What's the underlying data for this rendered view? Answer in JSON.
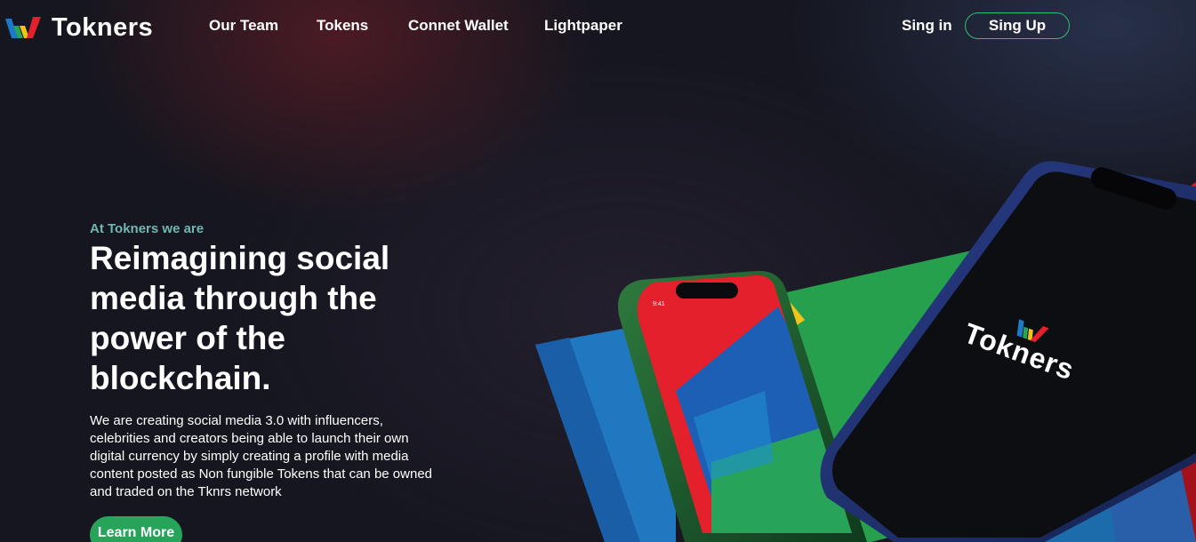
{
  "brand": {
    "name": "Tokners",
    "logo_icon": "tokners-w-logo-icon",
    "colors": {
      "blue": "#1e78c8",
      "green": "#27a35a",
      "yellow": "#f2c31b",
      "red": "#e3202b"
    }
  },
  "nav": {
    "items": [
      {
        "label": "Our Team"
      },
      {
        "label": "Tokens"
      },
      {
        "label": "Connet Wallet"
      },
      {
        "label": "Lightpaper"
      }
    ],
    "signin_label": "Sing in",
    "signup_label": "Sing Up"
  },
  "hero": {
    "eyebrow": "At Tokners we are",
    "headline": "Reimagining social media through the power of the blockchain.",
    "description": "We are creating social media 3.0 with influencers, celebrities and creators being able to launch their own digital currency by simply creating a profile with media content posted as Non fungible Tokens that can be owned and traded on the Tknrs network",
    "cta_label": "Learn More",
    "accent_color": "#6fb8b0"
  },
  "illustration": {
    "phone_back_time": "9:41",
    "phone_front_logo": "Tokners"
  }
}
